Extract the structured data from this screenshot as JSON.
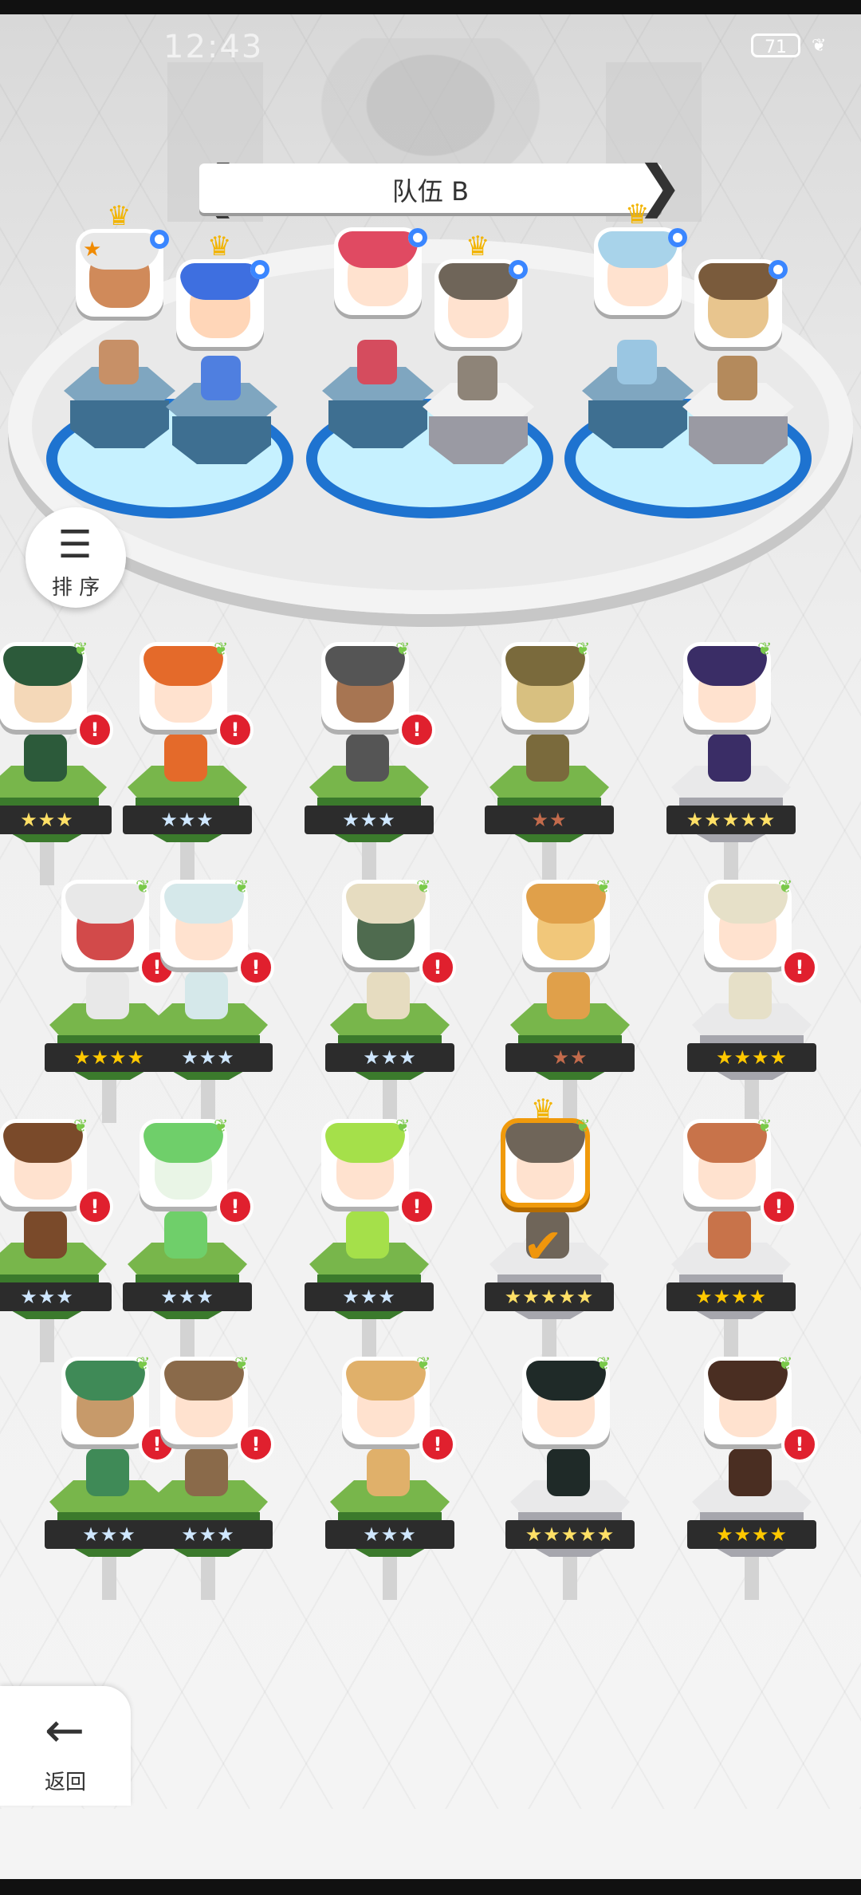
{
  "status": {
    "time": "12:43",
    "battery": "71"
  },
  "team": {
    "title": "队伍 B",
    "prev": "❮",
    "next": "❯"
  },
  "sort": {
    "label": "排 序",
    "icon": "sort-icon"
  },
  "back": {
    "label": "返回",
    "icon": "arrow-left-icon"
  },
  "colors": {
    "accent": "#f09a0c",
    "alert": "#e0202e",
    "slot_blue": "#1e73d0"
  },
  "team_members": [
    {
      "name": "member-1",
      "rank_star": "★",
      "crown": true,
      "hair": "#e7e7e7",
      "skin": "#d08a5a",
      "sprite": "#c79067"
    },
    {
      "name": "member-2",
      "crown": true,
      "hair": "#3e6fe0",
      "skin": "#ffd6b8",
      "sprite": "#4f7fe0"
    },
    {
      "name": "member-3",
      "crown": false,
      "hair": "#e04a62",
      "skin": "#ffe2cf",
      "sprite": "#d54c5e"
    },
    {
      "name": "member-4",
      "crown": true,
      "hair": "#6f6559",
      "skin": "#ffe2cf",
      "sprite": "#8e8478"
    },
    {
      "name": "member-5",
      "crown": true,
      "hair": "#a8d3ea",
      "skin": "#ffe2cf",
      "sprite": "#9ac6e2"
    },
    {
      "name": "member-6",
      "crown": false,
      "hair": "#7a5b3c",
      "skin": "#e8c58e",
      "sprite": "#b48a5c"
    }
  ],
  "roster": [
    {
      "row": 1,
      "heroes": [
        {
          "stars": "★★★",
          "type": "rainbow",
          "hair": "#2c5a3a",
          "skin": "#f4d8b8",
          "alert": "!"
        },
        {
          "stars": "★★★",
          "type": "silver",
          "hair": "#e46a2a",
          "skin": "#ffe2cf",
          "alert": "!"
        },
        {
          "stars": "★★★",
          "type": "silver",
          "hair": "#555",
          "skin": "#a77552",
          "alert": "!"
        },
        {
          "stars": "★★",
          "type": "bronze",
          "hair": "#7a6a3c",
          "skin": "#d8c080",
          "alert": ""
        },
        {
          "stars": "★★★★★",
          "type": "rainbow",
          "hair": "#3a2d66",
          "skin": "#ffe2cf",
          "alert": "",
          "white": true
        }
      ]
    },
    {
      "row": 2,
      "heroes": [
        {
          "stars": "★★★★",
          "type": "gold",
          "hair": "#e8e8e8",
          "skin": "#d24a4a",
          "alert": "!"
        },
        {
          "stars": "★★★",
          "type": "silver",
          "hair": "#d5e8ea",
          "skin": "#ffe2cf",
          "alert": "!"
        },
        {
          "stars": "★★★",
          "type": "silver",
          "hair": "#e6dcc0",
          "skin": "#4f6b4f",
          "alert": "!"
        },
        {
          "stars": "★★",
          "type": "bronze",
          "hair": "#e0a04a",
          "skin": "#f1c77a",
          "alert": ""
        },
        {
          "stars": "★★★★",
          "type": "gold",
          "hair": "#e6e0c8",
          "skin": "#ffe2cf",
          "alert": "!",
          "white": true
        }
      ]
    },
    {
      "row": 3,
      "heroes": [
        {
          "stars": "★★★",
          "type": "silver",
          "hair": "#7a4a2a",
          "skin": "#ffe2cf",
          "alert": "!"
        },
        {
          "stars": "★★★",
          "type": "silver",
          "hair": "#6fcf6a",
          "skin": "#e9f5e6",
          "alert": "!"
        },
        {
          "stars": "★★★",
          "type": "silver",
          "hair": "#a5e04a",
          "skin": "#ffe2cf",
          "alert": "!"
        },
        {
          "stars": "★★★★★",
          "type": "rainbow",
          "hair": "#6f6559",
          "skin": "#ffe2cf",
          "alert": "",
          "selected": true,
          "white": true
        },
        {
          "stars": "★★★★",
          "type": "gold",
          "hair": "#c8734a",
          "skin": "#ffe2cf",
          "alert": "!",
          "white": true
        }
      ]
    },
    {
      "row": 4,
      "heroes": [
        {
          "stars": "★★★",
          "type": "silver",
          "hair": "#3f8a57",
          "skin": "#c79a6a",
          "alert": "!"
        },
        {
          "stars": "★★★",
          "type": "silver",
          "hair": "#8a6a4a",
          "skin": "#ffe2cf",
          "alert": "!"
        },
        {
          "stars": "★★★",
          "type": "silver",
          "hair": "#e0b06a",
          "skin": "#ffe2cf",
          "alert": "!"
        },
        {
          "stars": "★★★★★",
          "type": "rainbow",
          "hair": "#1f2a28",
          "skin": "#ffe2cf",
          "alert": "",
          "white": true
        },
        {
          "stars": "★★★★",
          "type": "gold",
          "hair": "#4a2e22",
          "skin": "#ffe2cf",
          "alert": "!",
          "white": true
        }
      ]
    }
  ]
}
